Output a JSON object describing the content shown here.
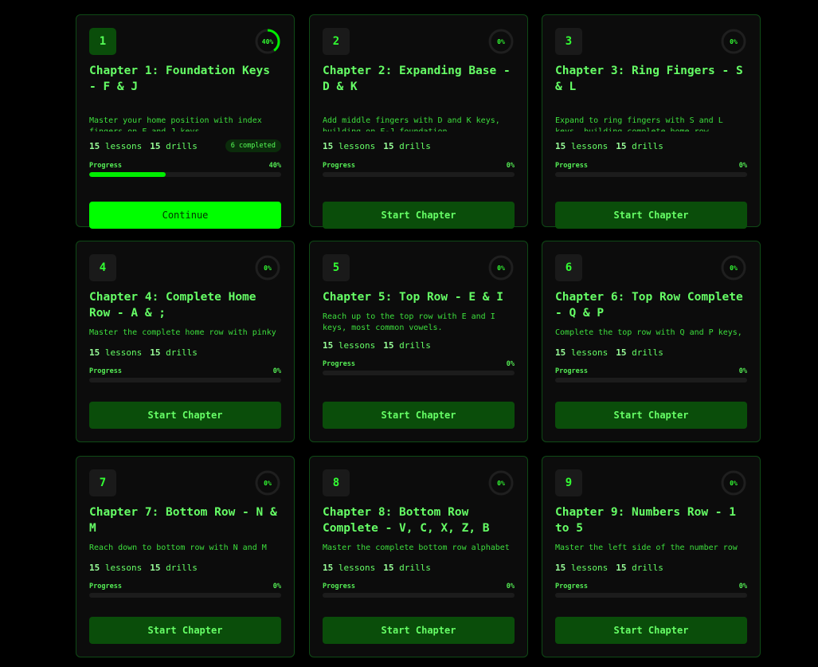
{
  "colors": {
    "accent": "#00ff00",
    "button_dark": "#0a4d0a",
    "card_bg": "#0c0c0c",
    "border": "#0f4a16"
  },
  "chapters": [
    {
      "number": "1",
      "title": "Chapter 1: Foundation Keys - F & J",
      "description": "Master your home position with index fingers on F and J keys",
      "lessons_count": "15",
      "lessons_label": "lessons",
      "drills_count": "15",
      "drills_label": "drills",
      "completed": "6 completed",
      "progress_label": "Progress",
      "progress_pct": "40%",
      "progress": 0.4,
      "ring_pct": "40%",
      "button": "Continue",
      "active": true
    },
    {
      "number": "2",
      "title": "Chapter 2: Expanding Base - D & K",
      "description": "Add middle fingers with D and K keys, building on F-J foundation",
      "lessons_count": "15",
      "lessons_label": "lessons",
      "drills_count": "15",
      "drills_label": "drills",
      "completed": "",
      "progress_label": "Progress",
      "progress_pct": "0%",
      "progress": 0,
      "ring_pct": "0%",
      "button": "Start Chapter",
      "active": false
    },
    {
      "number": "3",
      "title": "Chapter 3: Ring Fingers - S & L",
      "description": "Expand to ring fingers with S and L keys, building complete home row",
      "lessons_count": "15",
      "lessons_label": "lessons",
      "drills_count": "15",
      "drills_label": "drills",
      "completed": "",
      "progress_label": "Progress",
      "progress_pct": "0%",
      "progress": 0,
      "ring_pct": "0%",
      "button": "Start Chapter",
      "active": false
    },
    {
      "number": "4",
      "title": "Chapter 4: Complete Home Row - A & ;",
      "description": "Master the complete home row with pinky",
      "lessons_count": "15",
      "lessons_label": "lessons",
      "drills_count": "15",
      "drills_label": "drills",
      "completed": "",
      "progress_label": "Progress",
      "progress_pct": "0%",
      "progress": 0,
      "ring_pct": "0%",
      "button": "Start Chapter",
      "active": false
    },
    {
      "number": "5",
      "title": "Chapter 5: Top Row - E & I",
      "description": "Reach up to the top row with E and I keys, most common vowels.",
      "lessons_count": "15",
      "lessons_label": "lessons",
      "drills_count": "15",
      "drills_label": "drills",
      "completed": "",
      "progress_label": "Progress",
      "progress_pct": "0%",
      "progress": 0,
      "ring_pct": "0%",
      "button": "Start Chapter",
      "active": false
    },
    {
      "number": "6",
      "title": "Chapter 6: Top Row Complete - Q & P",
      "description": "Complete the top row with Q and P keys,",
      "lessons_count": "15",
      "lessons_label": "lessons",
      "drills_count": "15",
      "drills_label": "drills",
      "completed": "",
      "progress_label": "Progress",
      "progress_pct": "0%",
      "progress": 0,
      "ring_pct": "0%",
      "button": "Start Chapter",
      "active": false
    },
    {
      "number": "7",
      "title": "Chapter 7: Bottom Row - N & M",
      "description": "Reach down to bottom row with N and M",
      "lessons_count": "15",
      "lessons_label": "lessons",
      "drills_count": "15",
      "drills_label": "drills",
      "completed": "",
      "progress_label": "Progress",
      "progress_pct": "0%",
      "progress": 0,
      "ring_pct": "0%",
      "button": "Start Chapter",
      "active": false
    },
    {
      "number": "8",
      "title": "Chapter 8: Bottom Row Complete - V, C, X, Z, B",
      "description": "Master the complete bottom row alphabet",
      "lessons_count": "15",
      "lessons_label": "lessons",
      "drills_count": "15",
      "drills_label": "drills",
      "completed": "",
      "progress_label": "Progress",
      "progress_pct": "0%",
      "progress": 0,
      "ring_pct": "0%",
      "button": "Start Chapter",
      "active": false
    },
    {
      "number": "9",
      "title": "Chapter 9: Numbers Row - 1 to 5",
      "description": "Master the left side of the number row",
      "lessons_count": "15",
      "lessons_label": "lessons",
      "drills_count": "15",
      "drills_label": "drills",
      "completed": "",
      "progress_label": "Progress",
      "progress_pct": "0%",
      "progress": 0,
      "ring_pct": "0%",
      "button": "Start Chapter",
      "active": false
    }
  ]
}
